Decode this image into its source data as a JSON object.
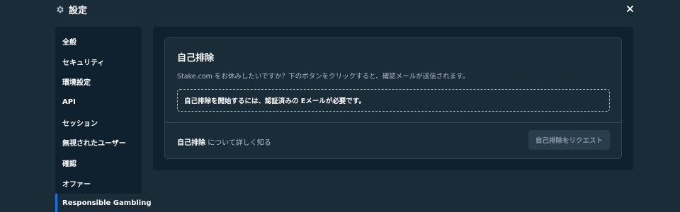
{
  "header": {
    "title": "設定",
    "icon": "gear-icon",
    "close_icon": "close-icon"
  },
  "sidebar": {
    "items": [
      {
        "label": "全般"
      },
      {
        "label": "セキュリティ"
      },
      {
        "label": "環境設定"
      },
      {
        "label": "API"
      },
      {
        "label": "セッション"
      },
      {
        "label": "無視されたユーザー"
      },
      {
        "label": "確認"
      },
      {
        "label": "オファー"
      },
      {
        "label": "Responsible Gambling",
        "active": true
      }
    ]
  },
  "card": {
    "title": "自己排除",
    "description": "Stake.com をお休みしたいですか？下のボタンをクリックすると、確認メールが送信されます。",
    "notice": "自己排除を開始するには、認証済みの Eメールが必要です。",
    "learn_link_bold": "自己排除",
    "learn_link_rest": " について詳しく知る",
    "request_button": "自己排除をリクエスト"
  },
  "colors": {
    "background": "#1a2c38",
    "panel": "#0f212e",
    "border": "#2f4553",
    "muted_text": "#b1bad3",
    "accent": "#1475e1"
  }
}
